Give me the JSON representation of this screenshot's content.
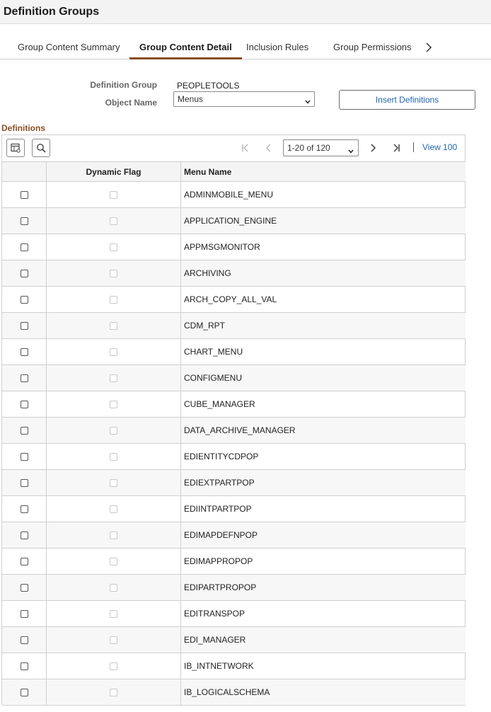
{
  "page": {
    "title": "Definition Groups"
  },
  "tabs": [
    {
      "label": "Group Content Summary",
      "active": false
    },
    {
      "label": "Group Content Detail",
      "active": true
    },
    {
      "label": "Inclusion Rules",
      "active": false
    },
    {
      "label": "Group Permissions",
      "active": false
    }
  ],
  "form": {
    "definition_group_label": "Definition Group",
    "definition_group_value": "PEOPLETOOLS",
    "object_name_label": "Object Name",
    "object_name_value": "Menus",
    "insert_button": "Insert Definitions"
  },
  "definitions": {
    "section_title": "Definitions",
    "pager": {
      "range": "1-20 of 120",
      "view_all": "View 100"
    },
    "columns": [
      "",
      "Dynamic Flag",
      "Menu Name"
    ],
    "rows": [
      {
        "menu_name": "ADMINMOBILE_MENU"
      },
      {
        "menu_name": "APPLICATION_ENGINE"
      },
      {
        "menu_name": "APPMSGMONITOR"
      },
      {
        "menu_name": "ARCHIVING"
      },
      {
        "menu_name": "ARCH_COPY_ALL_VAL"
      },
      {
        "menu_name": "CDM_RPT"
      },
      {
        "menu_name": "CHART_MENU"
      },
      {
        "menu_name": "CONFIGMENU"
      },
      {
        "menu_name": "CUBE_MANAGER"
      },
      {
        "menu_name": "DATA_ARCHIVE_MANAGER"
      },
      {
        "menu_name": "EDIENTITYCDPOP"
      },
      {
        "menu_name": "EDIEXTPARTPOP"
      },
      {
        "menu_name": "EDIINTPARTPOP"
      },
      {
        "menu_name": "EDIMAPDEFNPOP"
      },
      {
        "menu_name": "EDIMAPPROPOP"
      },
      {
        "menu_name": "EDIPARTPROPOP"
      },
      {
        "menu_name": "EDITRANSPOP"
      },
      {
        "menu_name": "EDI_MANAGER"
      },
      {
        "menu_name": "IB_INTNETWORK"
      },
      {
        "menu_name": "IB_LOGICALSCHEMA"
      }
    ]
  },
  "colors": {
    "accent": "#8a4d24",
    "link": "#1f66b0"
  },
  "icons": [
    "chevron-right-icon",
    "chevron-down-icon",
    "grid-settings-icon",
    "search-icon",
    "first-page-icon",
    "prev-page-icon",
    "next-page-icon",
    "last-page-icon"
  ]
}
